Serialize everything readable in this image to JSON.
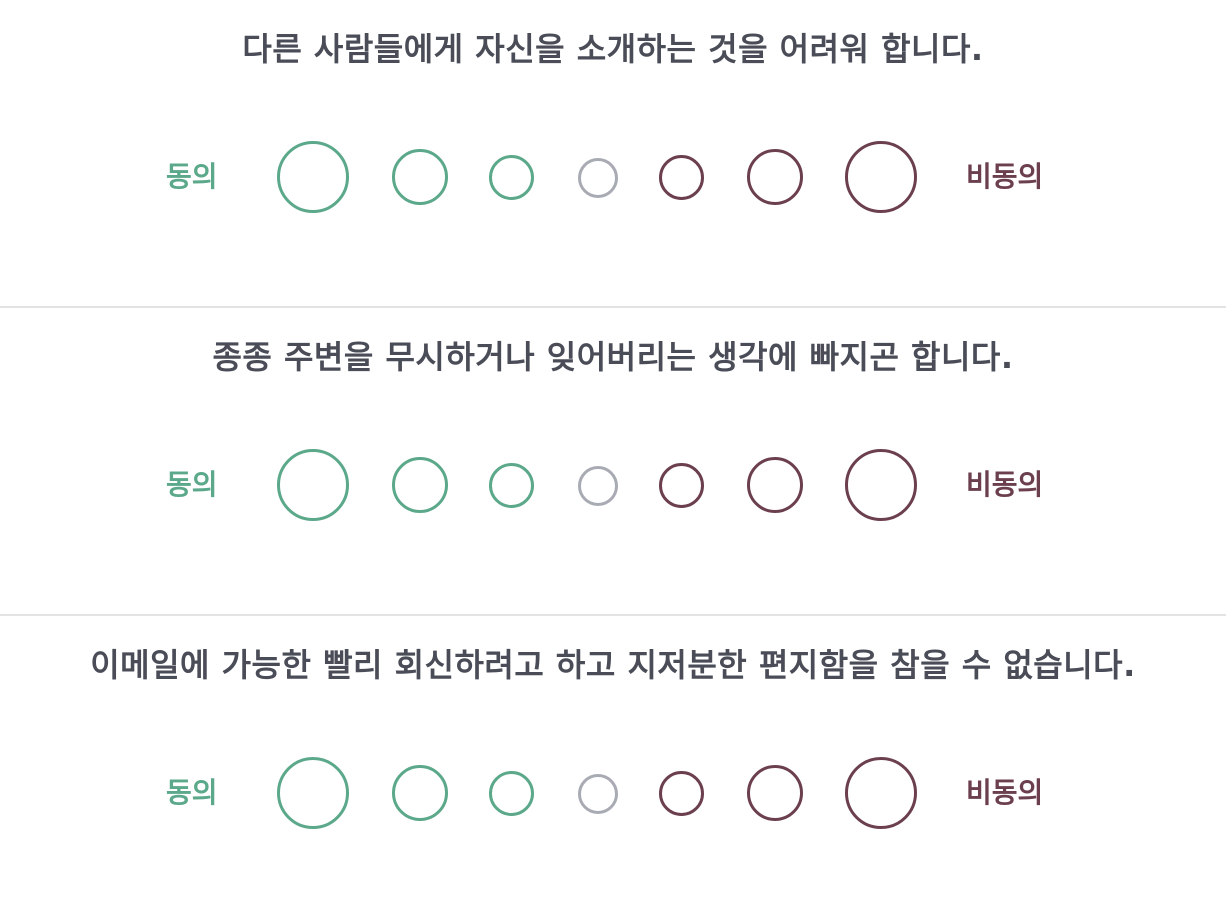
{
  "scale_labels": {
    "agree": "동의",
    "disagree": "비동의"
  },
  "colors": {
    "agree": "#5ba88a",
    "neutral": "#a9abb4",
    "disagree": "#6b3f4e",
    "question_text": "#4a4d57",
    "divider": "#e3e3e3"
  },
  "questions": [
    {
      "text": "다른 사람들에게 자신을 소개하는 것을 어려워 합니다.",
      "selected": null
    },
    {
      "text": "종종 주변을 무시하거나 잊어버리는 생각에 빠지곤 합니다.",
      "selected": null
    },
    {
      "text": "이메일에 가능한 빨리 회신하려고 하고 지저분한 편지함을 참을 수 없습니다.",
      "selected": null
    }
  ],
  "options_per_question": 7
}
